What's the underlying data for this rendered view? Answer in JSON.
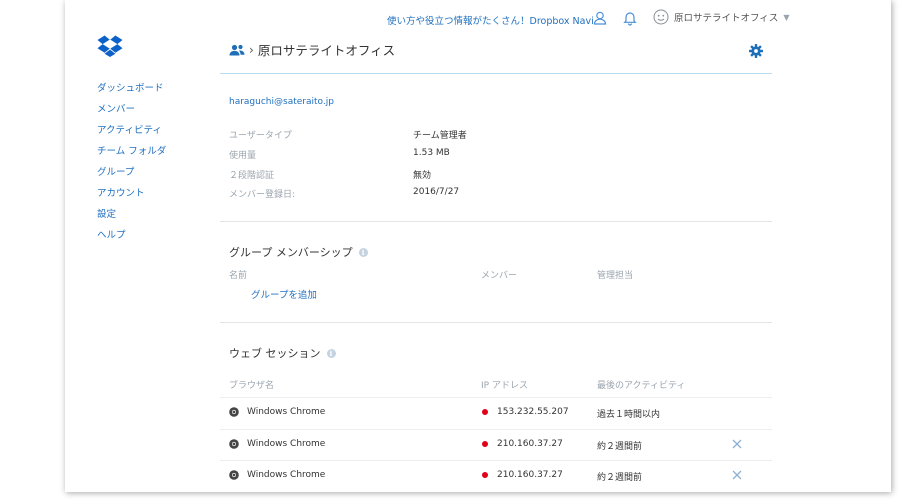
{
  "topbar": {
    "navi_link": "使い方や役立つ情報がたくさん！Dropbox Navi",
    "account_name": "原ロサテライトオフィス"
  },
  "sidebar": {
    "items": [
      {
        "label": "ダッシュボード"
      },
      {
        "label": "メンバー"
      },
      {
        "label": "アクティビティ"
      },
      {
        "label": "チーム フォルダ"
      },
      {
        "label": "グループ"
      },
      {
        "label": "アカウント"
      },
      {
        "label": "設定"
      },
      {
        "label": "ヘルプ"
      }
    ]
  },
  "header": {
    "separator": "›",
    "title": "原ロサテライトオフィス"
  },
  "member": {
    "email": "haraguchi@sateraito.jp",
    "info": [
      {
        "label": "ユーザータイプ",
        "value": "チーム管理者"
      },
      {
        "label": "使用量",
        "value": "1.53 MB"
      },
      {
        "label": "２段階認証",
        "value": "無効"
      },
      {
        "label": "メンバー登録日:",
        "value": "2016/7/27"
      }
    ]
  },
  "groups": {
    "title": "グループ メンバーシップ",
    "info_glyph": "i",
    "columns": {
      "name": "名前",
      "members": "メンバー",
      "managed": "管理担当"
    },
    "add_link": "グループを追加"
  },
  "sessions": {
    "title": "ウェブ セッション",
    "info_glyph": "i",
    "columns": {
      "browser": "ブラウザ名",
      "ip": "IP アドレス",
      "activity": "最後のアクティビティ"
    },
    "rows": [
      {
        "browser": "Windows Chrome",
        "ip": "153.232.55.207",
        "activity": "過去１時間以内",
        "removable": false
      },
      {
        "browser": "Windows Chrome",
        "ip": "210.160.37.27",
        "activity": "約２週間前",
        "removable": true
      },
      {
        "browser": "Windows Chrome",
        "ip": "210.160.37.27",
        "activity": "約２週間前",
        "removable": true
      }
    ]
  },
  "colors": {
    "link": "#1f70c1",
    "accent": "#1f6fb8",
    "muted": "#9aa4ae",
    "flag_red": "#e3001b"
  }
}
